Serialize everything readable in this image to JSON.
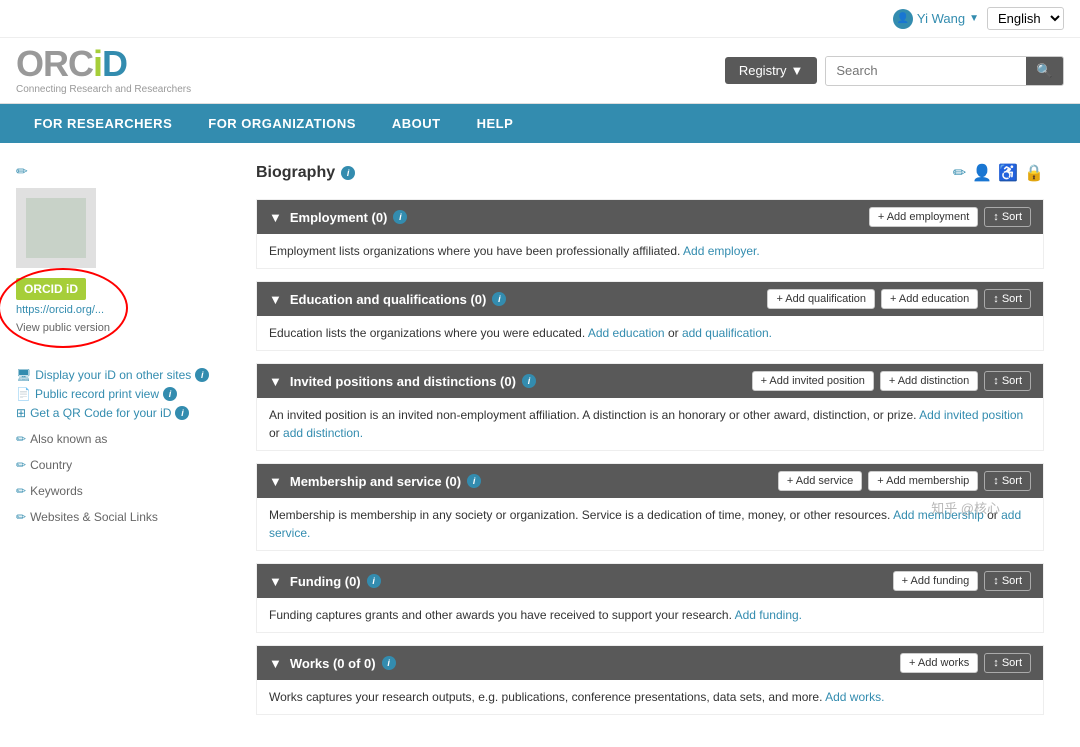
{
  "topbar": {
    "user_name": "Yi Wang",
    "language": "English",
    "chevron": "▼"
  },
  "header": {
    "logo": {
      "orc": "ORC",
      "i": "i",
      "d": "D",
      "subtitle": "Connecting Research and Researchers"
    },
    "registry_btn": "Registry",
    "search_placeholder": "Search"
  },
  "nav": {
    "items": [
      {
        "label": "FOR RESEARCHERS"
      },
      {
        "label": "FOR ORGANIZATIONS"
      },
      {
        "label": "ABOUT"
      },
      {
        "label": "HELP"
      }
    ]
  },
  "sidebar": {
    "edit_icon": "✏",
    "orcid_id_label": "ORCID iD",
    "orcid_url": "https://orcid.org/...",
    "view_public": "View public version",
    "links": [
      {
        "icon": "🖵",
        "text": "Display your iD on other sites",
        "has_info": true
      },
      {
        "icon": "📄",
        "text": "Public record print view",
        "has_info": true
      },
      {
        "icon": "⊞",
        "text": "Get a QR Code for your iD",
        "has_info": true
      }
    ],
    "also_known_as": "Also known as",
    "country": "Country",
    "keywords": "Keywords",
    "websites_social": "Websites & Social Links"
  },
  "biography": {
    "title": "Biography",
    "info_icon": "i"
  },
  "sections": [
    {
      "id": "employment",
      "title": "Employment (0)",
      "has_info": true,
      "actions": [
        {
          "label": "+ Add employment"
        },
        {
          "label": "↕ Sort"
        }
      ],
      "description": "Employment lists organizations where you have been professionally affiliated.",
      "link_text": "Add employer.",
      "link_inline": true
    },
    {
      "id": "education",
      "title": "Education and qualifications (0)",
      "has_info": true,
      "actions": [
        {
          "label": "+ Add qualification"
        },
        {
          "label": "+ Add education"
        },
        {
          "label": "↕ Sort"
        }
      ],
      "description": "Education lists the organizations where you were educated.",
      "links": [
        "Add education",
        "add qualification"
      ]
    },
    {
      "id": "invited",
      "title": "Invited positions and distinctions (0)",
      "has_info": true,
      "actions": [
        {
          "label": "+ Add invited position"
        },
        {
          "label": "+ Add distinction"
        },
        {
          "label": "↕ Sort"
        }
      ],
      "description": "An invited position is an invited non-employment affiliation. A distinction is an honorary or other award, distinction, or prize.",
      "links": [
        "Add invited position",
        "add distinction"
      ]
    },
    {
      "id": "membership",
      "title": "Membership and service (0)",
      "has_info": true,
      "actions": [
        {
          "label": "+ Add service"
        },
        {
          "label": "+ Add membership"
        },
        {
          "label": "↕ Sort"
        }
      ],
      "description": "Membership is membership in any society or organization. Service is a dedication of time, money, or other resources.",
      "links": [
        "Add membership",
        "add service"
      ]
    },
    {
      "id": "funding",
      "title": "Funding (0)",
      "has_info": true,
      "actions": [
        {
          "label": "+ Add funding"
        },
        {
          "label": "↕ Sort"
        }
      ],
      "description": "Funding captures grants and other awards you have received to support your research.",
      "links": [
        "Add funding."
      ]
    },
    {
      "id": "works",
      "title": "Works (0 of 0)",
      "has_info": true,
      "actions": [
        {
          "label": "+ Add works"
        },
        {
          "label": "↕ Sort"
        }
      ],
      "description": "Works captures your research outputs, e.g. publications, conference presentations, data sets, and more.",
      "links": [
        "Add works."
      ]
    }
  ]
}
